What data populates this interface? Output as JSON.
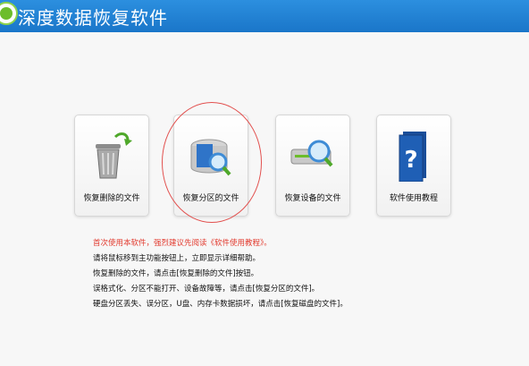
{
  "app": {
    "title": "深度数据恢复软件"
  },
  "cards": [
    {
      "label": "恢复删除的文件",
      "icon": "recycle-bin-icon"
    },
    {
      "label": "恢复分区的文件",
      "icon": "partition-disk-search-icon"
    },
    {
      "label": "恢复设备的文件",
      "icon": "device-drive-search-icon"
    },
    {
      "label": "软件使用教程",
      "icon": "help-book-icon"
    }
  ],
  "instructions": [
    "首次使用本软件，强烈建议先阅读《软件使用教程》。",
    "请将鼠标移到主功能按钮上，立即显示详细帮助。",
    "恢复删除的文件，请点击[恢复删除的文件]按钮。",
    "误格式化、分区不能打开、设备故障等，请点击[恢复分区的文件]。",
    "硬盘分区丢失、误分区，U盘、内存卡数据损坏，请点击[恢复磁盘的文件]。"
  ],
  "colors": {
    "titlebar": "#2a86d8",
    "warning": "#e23a2e",
    "ring": "#e2504e"
  }
}
